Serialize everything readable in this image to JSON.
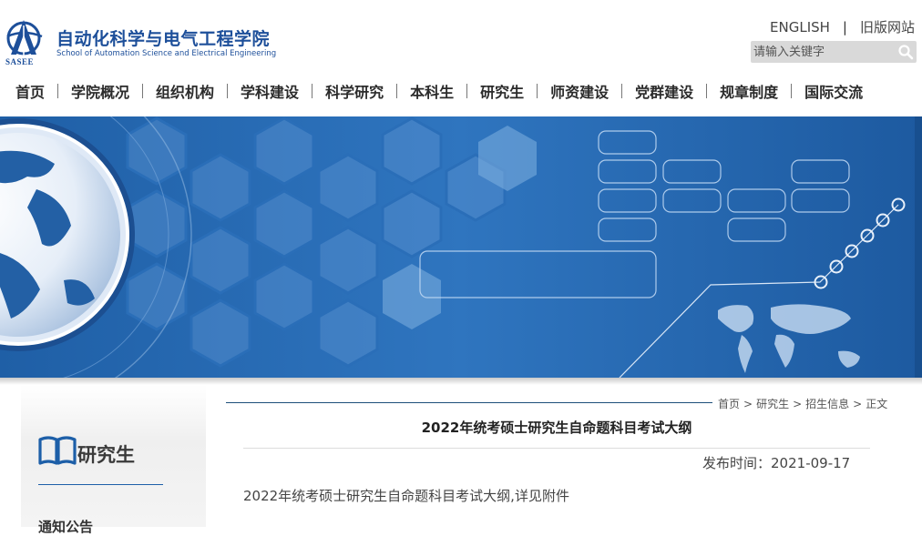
{
  "header": {
    "logo_cn": "自动化科学与电气工程学院",
    "logo_en": "School of Automation Science and Electrical Engineering",
    "logo_abbr": "SASEE",
    "links": {
      "english": "ENGLISH",
      "separator": "|",
      "old_site": "旧版网站"
    },
    "search": {
      "placeholder": "请输入关键字"
    }
  },
  "nav": {
    "items": [
      "首页",
      "学院概况",
      "组织机构",
      "学科建设",
      "科学研究",
      "本科生",
      "研究生",
      "师资建设",
      "党群建设",
      "规章制度",
      "国际交流"
    ]
  },
  "sidebar": {
    "title": "研究生",
    "next_item": "通知公告"
  },
  "breadcrumb": {
    "items": [
      "首页",
      "研究生",
      "招生信息",
      "正文"
    ],
    "sep": ">"
  },
  "article": {
    "title": "2022年统考硕士研究生自命题科目考试大纲",
    "date_label": "发布时间：",
    "date": "2021-09-17",
    "body": "2022年统考硕士研究生自命题科目考试大纲,详见附件"
  },
  "colors": {
    "brand_blue": "#1d4f9a",
    "banner_blue": "#2a6eb8",
    "search_bg": "#d9d9d9"
  },
  "icons": [
    "search-icon",
    "book-icon",
    "logo-emblem"
  ]
}
